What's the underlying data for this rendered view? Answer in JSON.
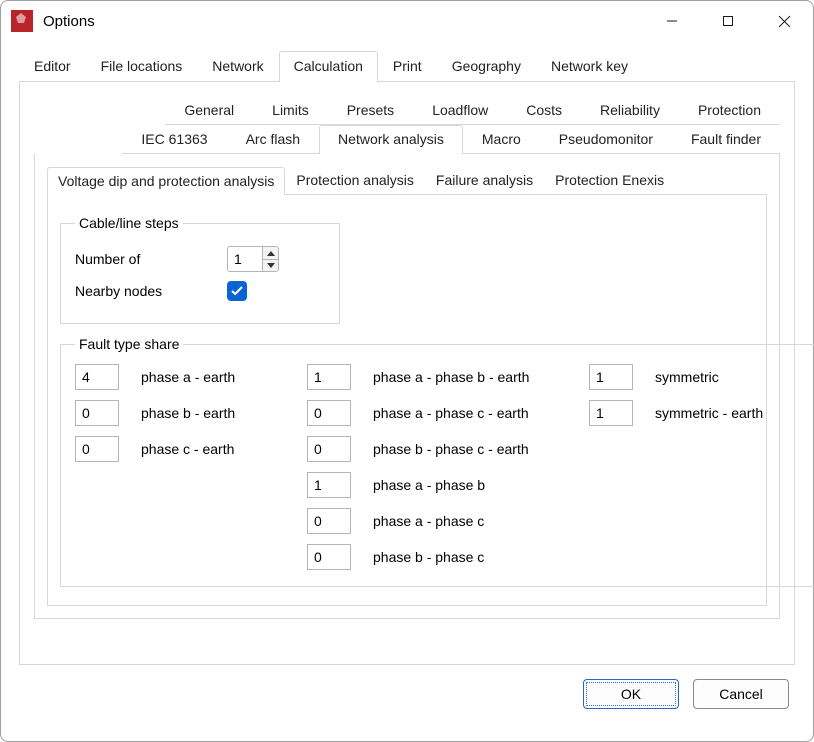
{
  "window": {
    "title": "Options"
  },
  "main_tabs": {
    "items": [
      "Editor",
      "File locations",
      "Network",
      "Calculation",
      "Print",
      "Geography",
      "Network key"
    ],
    "active": "Calculation"
  },
  "sub_tabs": {
    "row1": [
      "General",
      "Limits",
      "Presets",
      "Loadflow",
      "Costs",
      "Reliability",
      "Protection"
    ],
    "row2": [
      "IEC 61363",
      "Arc flash",
      "Network analysis",
      "Macro",
      "Pseudomonitor",
      "Fault finder"
    ],
    "active": "Network analysis"
  },
  "sub_sub_tabs": {
    "items": [
      "Voltage dip and protection analysis",
      "Protection analysis",
      "Failure analysis",
      "Protection Enexis"
    ],
    "active": "Voltage dip and protection analysis"
  },
  "cable_line_steps": {
    "legend": "Cable/line steps",
    "number_of_label": "Number of",
    "number_of_value": "1",
    "nearby_nodes_label": "Nearby nodes",
    "nearby_nodes_checked": true
  },
  "fault_type_share": {
    "legend": "Fault type share",
    "rows": [
      {
        "c1_val": "4",
        "c1_lbl": "phase a - earth",
        "c2_val": "1",
        "c2_lbl": "phase a - phase b - earth",
        "c3_val": "1",
        "c3_lbl": "symmetric"
      },
      {
        "c1_val": "0",
        "c1_lbl": "phase b - earth",
        "c2_val": "0",
        "c2_lbl": "phase a - phase c - earth",
        "c3_val": "1",
        "c3_lbl": "symmetric - earth"
      },
      {
        "c1_val": "0",
        "c1_lbl": "phase c - earth",
        "c2_val": "0",
        "c2_lbl": "phase b - phase c - earth"
      },
      {
        "c2_val": "1",
        "c2_lbl": "phase a - phase b"
      },
      {
        "c2_val": "0",
        "c2_lbl": "phase a - phase c"
      },
      {
        "c2_val": "0",
        "c2_lbl": "phase b - phase c"
      }
    ]
  },
  "buttons": {
    "ok": "OK",
    "cancel": "Cancel"
  }
}
